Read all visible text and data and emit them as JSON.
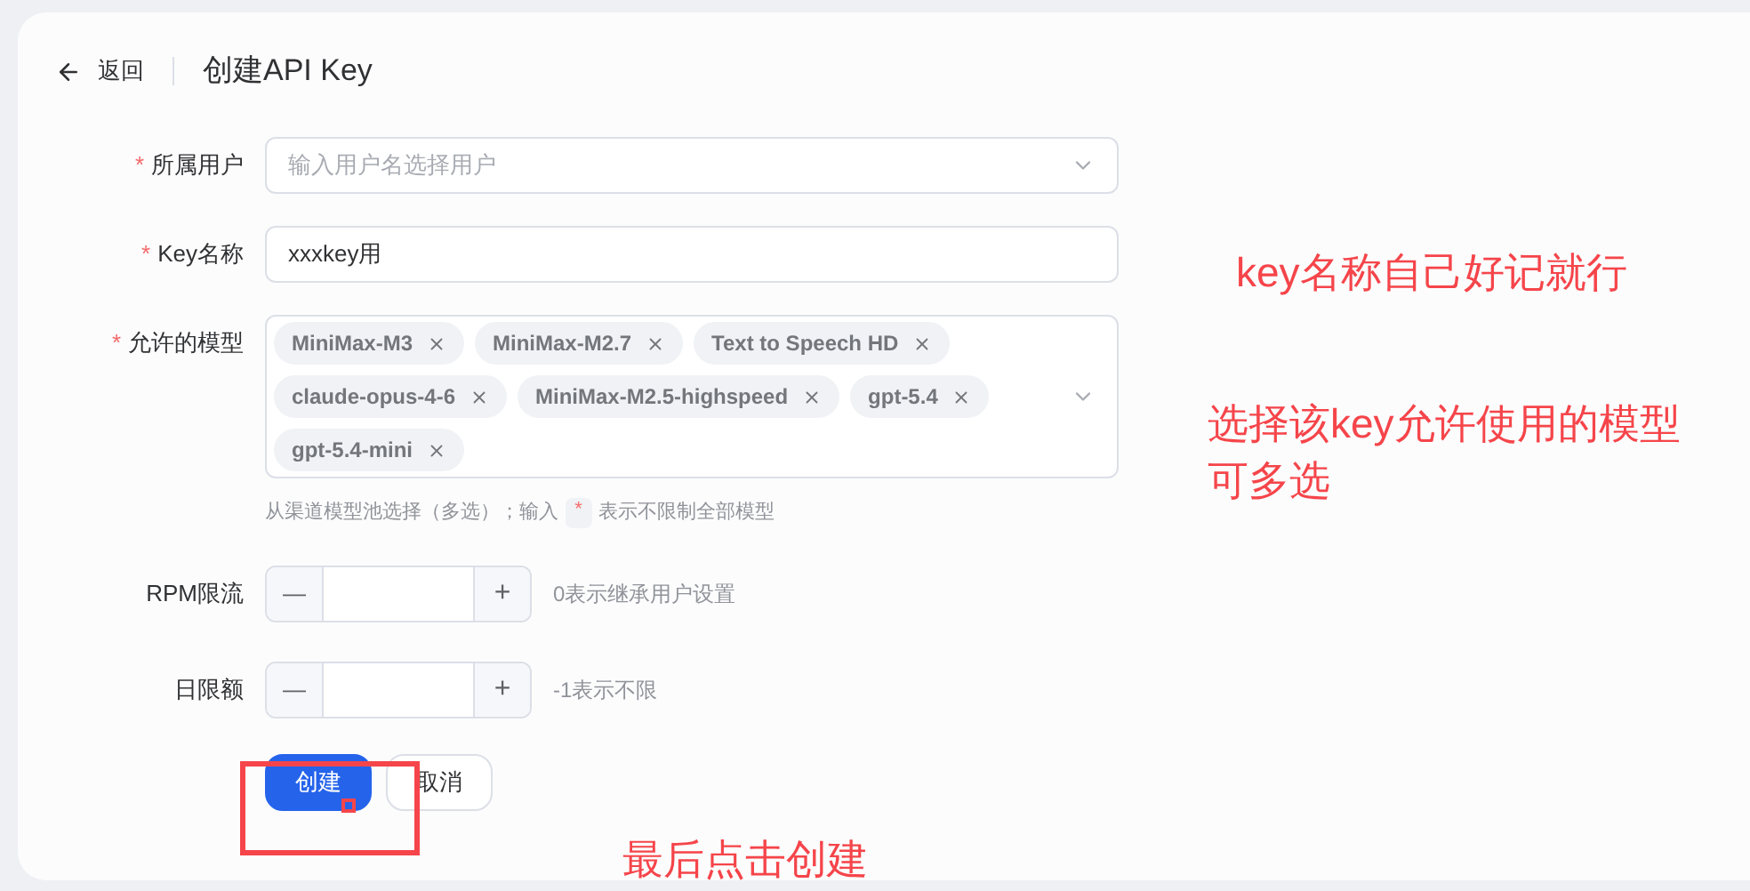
{
  "header": {
    "back": "返回",
    "title": "创建API Key"
  },
  "form": {
    "user": {
      "label": "所属用户",
      "required": true,
      "placeholder": "输入用户名选择用户"
    },
    "key_name": {
      "label": "Key名称",
      "required": true,
      "value": "xxxkey用"
    },
    "models": {
      "label": "允许的模型",
      "required": true,
      "tags": [
        {
          "text": "MiniMax-M3"
        },
        {
          "text": "MiniMax-M2.7"
        },
        {
          "text": "Text to Speech HD"
        },
        {
          "text": "claude-opus-4-6"
        },
        {
          "text": "MiniMax-M2.5-highspeed"
        },
        {
          "text": "gpt-5.4"
        },
        {
          "text": "gpt-5.4-mini"
        }
      ],
      "hint_before": "从渠道模型池选择（多选）；输入",
      "hint_code": "*",
      "hint_after": "表示不限制全部模型"
    },
    "rpm": {
      "label": "RPM限流",
      "minus": "—",
      "plus": "+",
      "hint": "0表示继承用户设置"
    },
    "daily": {
      "label": "日限额",
      "minus": "—",
      "plus": "+",
      "hint": "-1表示不限"
    },
    "buttons": [
      {
        "text": "创建",
        "kind": "primary"
      },
      {
        "text": "取消",
        "kind": "default"
      }
    ]
  },
  "annotations": [
    {
      "text": "key名称自己好记就行"
    },
    {
      "text": "选择该key允许使用的模型"
    },
    {
      "text": "可多选"
    },
    {
      "text": "最后点击创建"
    }
  ]
}
